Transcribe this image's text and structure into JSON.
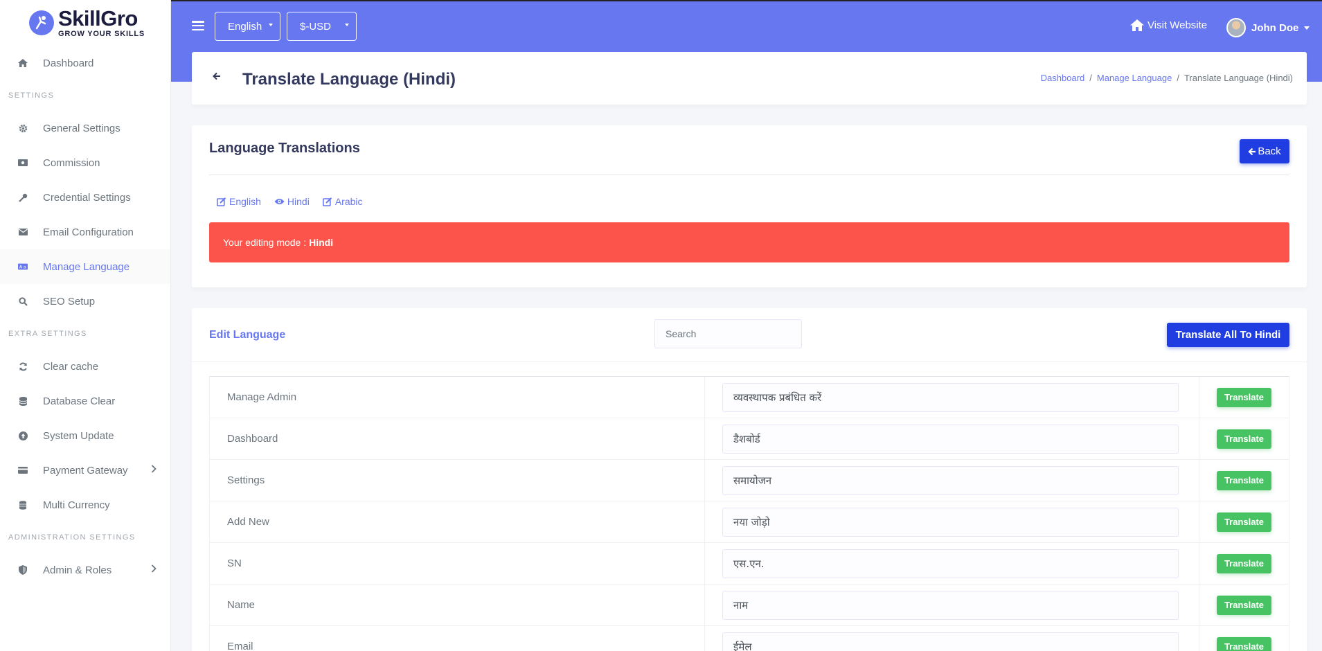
{
  "brand": {
    "name": "SkillGro",
    "tagline": "GROW YOUR SKILLS"
  },
  "sidebar": {
    "dashboard": "Dashboard",
    "settings_header": "SETTINGS",
    "general_settings": "General Settings",
    "commission": "Commission",
    "credential_settings": "Credential Settings",
    "email_configuration": "Email Configuration",
    "manage_language": "Manage Language",
    "seo_setup": "SEO Setup",
    "extra_header": "EXTRA SETTINGS",
    "clear_cache": "Clear cache",
    "database_clear": "Database Clear",
    "system_update": "System Update",
    "payment_gateway": "Payment Gateway",
    "multi_currency": "Multi Currency",
    "admin_header": "ADMINISTRATION SETTINGS",
    "admin_roles": "Admin & Roles"
  },
  "topbar": {
    "language": "English",
    "currency": "$-USD",
    "visit_website": "Visit Website",
    "user_name": "John Doe"
  },
  "header": {
    "title": "Translate Language (Hindi)",
    "breadcrumb": [
      "Dashboard",
      "Manage Language",
      "Translate Language (Hindi)"
    ]
  },
  "translations_card": {
    "title": "Language Translations",
    "back_label": "Back",
    "links": [
      "English",
      "Hindi",
      "Arabic"
    ],
    "alert_prefix": "Your editing mode :",
    "alert_lang": "Hindi"
  },
  "edit_card": {
    "title": "Edit Language",
    "search_placeholder": "Search",
    "translate_all_label": "Translate All To Hindi",
    "translate_label": "Translate",
    "rows": [
      {
        "key": "Manage Admin",
        "value": "व्यवस्थापक प्रबंधित करें"
      },
      {
        "key": "Dashboard",
        "value": "डैशबोर्ड"
      },
      {
        "key": "Settings",
        "value": "समायोजन"
      },
      {
        "key": "Add New",
        "value": "नया जोड़ो"
      },
      {
        "key": "SN",
        "value": "एस.एन."
      },
      {
        "key": "Name",
        "value": "नाम"
      },
      {
        "key": "Email",
        "value": "ईमेल"
      }
    ]
  },
  "colors": {
    "primary": "#6777ef",
    "button_blue": "#1f3de0",
    "alert_red": "#fc544b",
    "success_green": "#47c363"
  }
}
